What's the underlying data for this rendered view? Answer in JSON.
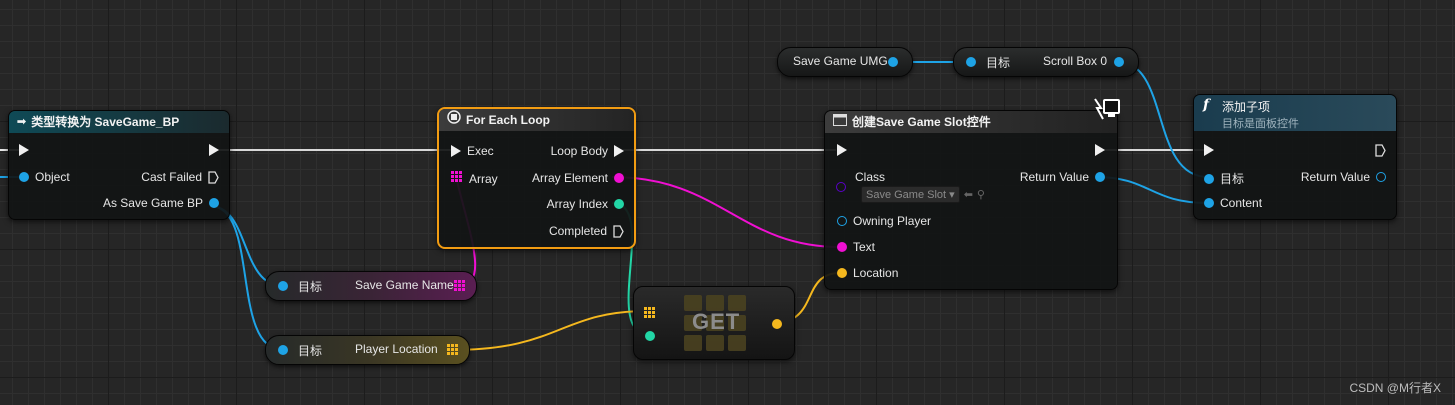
{
  "nodes": {
    "cast": {
      "title": "类型转换为 SaveGame_BP",
      "pin_object": "Object",
      "pin_cast_failed": "Cast Failed",
      "pin_as": "As Save Game BP"
    },
    "target_savename": {
      "target": "目标",
      "label": "Save Game Name"
    },
    "target_location": {
      "target": "目标",
      "label": "Player Location"
    },
    "foreach": {
      "title": "For Each Loop",
      "exec": "Exec",
      "loop_body": "Loop Body",
      "array": "Array",
      "array_element": "Array Element",
      "array_index": "Array Index",
      "completed": "Completed"
    },
    "get": {
      "label": "GET"
    },
    "savegame_umg": {
      "label": "Save Game UMG"
    },
    "scrollbox": {
      "target": "目标",
      "label": "Scroll Box 0"
    },
    "create": {
      "title": "创建Save Game Slot控件",
      "class": "Class",
      "class_value": "Save Game Slot",
      "return_value": "Return Value",
      "owning_player": "Owning Player",
      "text": "Text",
      "location": "Location"
    },
    "addchild": {
      "title": "添加子项",
      "subtitle": "目标是面板控件",
      "target": "目标",
      "return_value": "Return Value",
      "content": "Content"
    }
  },
  "colors": {
    "object_blue": "#1ea3e6",
    "string_magenta": "#f00fd2",
    "int_teal": "#22d6a6",
    "struct_yellow": "#f5b81e",
    "class_purple": "#5a00c8",
    "header_teal": "#0f4a56",
    "header_grey": "#3c3c3c",
    "header_addchild": "#1a3c4e",
    "foreach_border": "#f29c12"
  },
  "watermark": "CSDN @M行者X"
}
